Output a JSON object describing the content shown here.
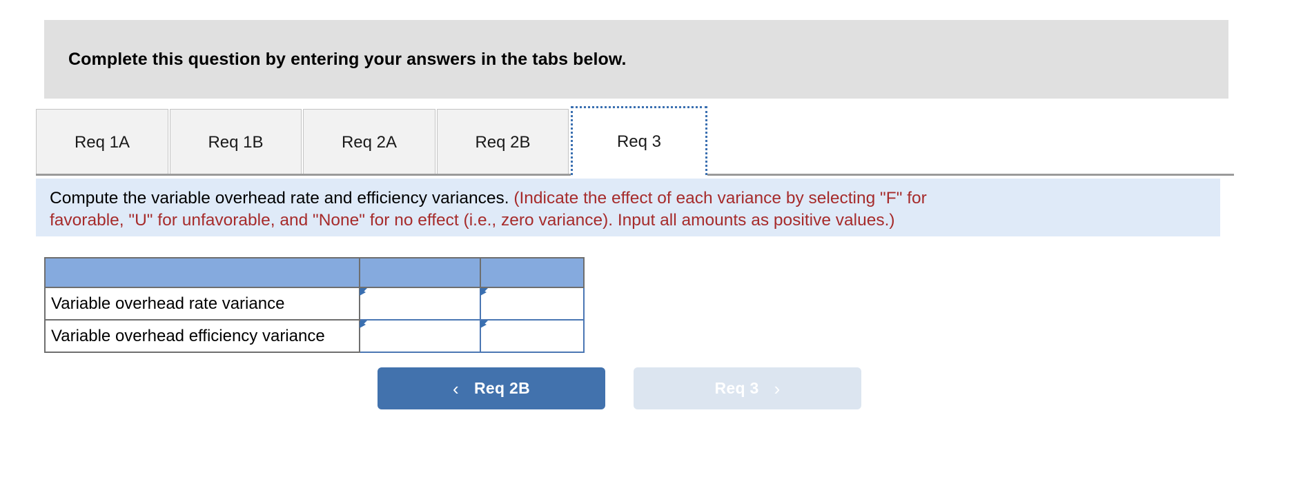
{
  "header": {
    "title": "Complete this question by entering your answers in the tabs below."
  },
  "tabs": [
    {
      "label": "Req 1A",
      "active": false
    },
    {
      "label": "Req 1B",
      "active": false
    },
    {
      "label": "Req 2A",
      "active": false
    },
    {
      "label": "Req 2B",
      "active": false
    },
    {
      "label": "Req 3",
      "active": true
    }
  ],
  "instruction": {
    "line1_black": "Compute the variable overhead rate and efficiency variances.",
    "line1_red": "(Indicate the effect of each variance by selecting \"F\" for",
    "line2_red": "favorable, \"U\" for unfavorable, and \"None\" for no effect (i.e., zero variance). Input all amounts as positive values.)"
  },
  "table": {
    "headers": [
      "",
      "",
      ""
    ],
    "rows": [
      {
        "label": "Variable overhead rate variance",
        "amount": "",
        "effect": ""
      },
      {
        "label": "Variable overhead efficiency variance",
        "amount": "",
        "effect": ""
      }
    ]
  },
  "nav": {
    "prev_label": "Req 2B",
    "prev_icon": "chevron-left-icon",
    "next_label": "Req 3",
    "next_icon": "chevron-right-icon",
    "prev_chevron": "‹",
    "next_chevron": "›"
  },
  "colors": {
    "header_bar_bg": "#e0e0e0",
    "instruction_bg": "#dfeaf8",
    "instruction_red": "#a62b2b",
    "table_header_blue": "#85aade",
    "input_border_blue": "#4a76b3",
    "marker_blue": "#3a6fb0",
    "btn_primary": "#4272ad",
    "btn_disabled": "#dce5f0",
    "tab_inactive_bg": "#f2f2f2",
    "tab_active_bg": "#ffffff",
    "tab_focus_outline": "#3a6fb0"
  }
}
